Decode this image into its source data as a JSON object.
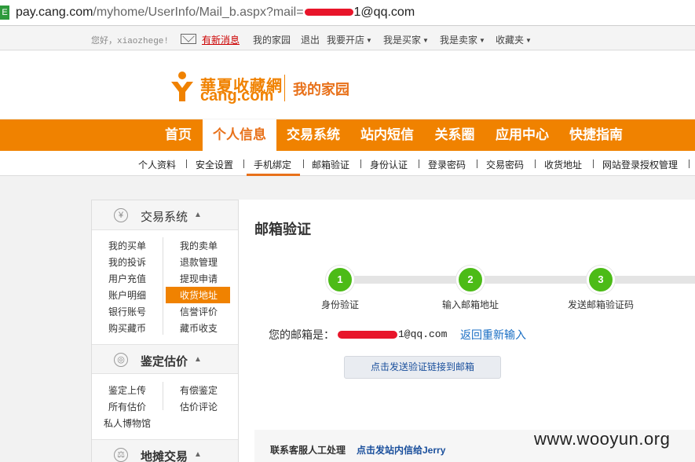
{
  "browser": {
    "url_host": "pay.cang.com",
    "url_path": "/myhome/UserInfo/Mail_b.aspx?mail=",
    "url_tail": "1@qq.com"
  },
  "topbar": {
    "greeting": "您好，xiaozhege!",
    "new_message": "有新消息",
    "my_home": "我的家园",
    "logout": "退出",
    "open_shop": "我要开店",
    "buyer": "我是买家",
    "seller": "我是卖家",
    "favorites": "收藏夹"
  },
  "header": {
    "logo_cn": "華夏收藏網",
    "logo_en": "cang.com",
    "section": "我的家园"
  },
  "nav": {
    "tabs": [
      "首页",
      "个人信息",
      "交易系统",
      "站内短信",
      "关系圈",
      "应用中心",
      "快捷指南"
    ]
  },
  "subnav": {
    "items": [
      "个人资料",
      "安全设置",
      "手机绑定",
      "邮箱验证",
      "身份认证",
      "登录密码",
      "交易密码",
      "收货地址",
      "网站登录授权管理"
    ]
  },
  "sidebar": {
    "trade": {
      "title": "交易系统",
      "left": [
        "我的买单",
        "我的投诉",
        "用户充值",
        "账户明细",
        "银行账号",
        "购买藏币"
      ],
      "right": [
        "我的卖单",
        "退款管理",
        "提现申请",
        "收货地址",
        "信誉评价",
        "藏币收支"
      ]
    },
    "appraise": {
      "title": "鉴定估价",
      "left": [
        "鉴定上传",
        "所有估价",
        "私人博物馆"
      ],
      "right": [
        "有偿鉴定",
        "估价评论"
      ]
    },
    "market": {
      "title": "地摊交易"
    }
  },
  "main": {
    "title": "邮箱验证",
    "steps": [
      {
        "num": "1",
        "label": "身份验证"
      },
      {
        "num": "2",
        "label": "输入邮箱地址"
      },
      {
        "num": "3",
        "label": "发送邮箱验证码"
      }
    ],
    "email_label": "您的邮箱是：",
    "email_tail": "1@qq.com",
    "reenter": "返回重新输入",
    "send_button": "点击发送验证链接到邮箱",
    "contact_label": "联系客服人工处理",
    "contact_link": "点击发站内信给Jerry"
  },
  "watermark": "www.wooyun.org",
  "colors": {
    "brand_orange": "#f08200",
    "step_green": "#4cbb17",
    "link_blue": "#1a6fc4",
    "redact_red": "#e8152a"
  }
}
